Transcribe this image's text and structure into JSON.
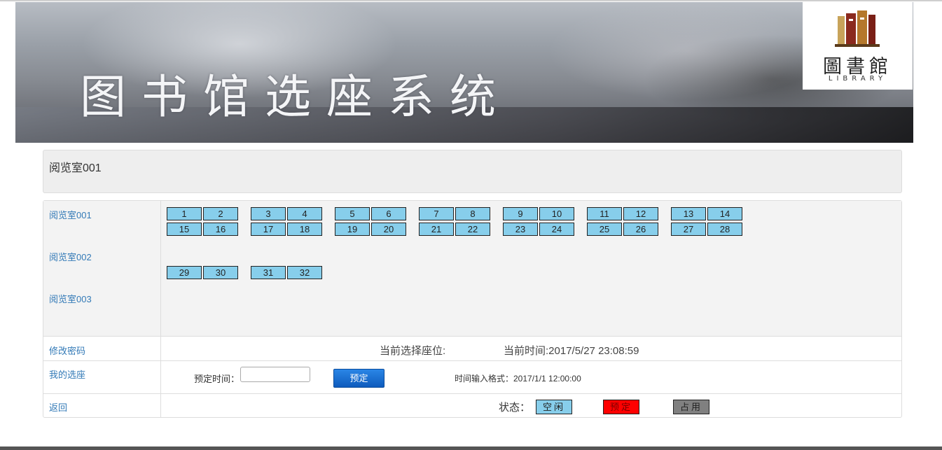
{
  "banner": {
    "title": "图书馆选座系统",
    "logo_cn": "圖書館",
    "logo_en": "LIBRARY"
  },
  "header": {
    "room_title": "阅览室001"
  },
  "sidebar": {
    "rooms": [
      "阅览室001",
      "阅览室002",
      "阅览室003"
    ],
    "actions": [
      "修改密码",
      "我的选座",
      "返回"
    ]
  },
  "seats": {
    "row1": [
      "1",
      "2",
      "3",
      "4",
      "5",
      "6",
      "7",
      "8",
      "9",
      "10",
      "11",
      "12",
      "13",
      "14"
    ],
    "row2": [
      "15",
      "16",
      "17",
      "18",
      "19",
      "20",
      "21",
      "22",
      "23",
      "24",
      "25",
      "26",
      "27",
      "28"
    ],
    "row3": [
      "29",
      "30",
      "31",
      "32"
    ],
    "colors": {
      "free": "#87ceeb",
      "booked": "#ff0000",
      "occupied": "#808080"
    }
  },
  "info": {
    "current_seat_label": "当前选择座位:",
    "current_time_label": "当前时间:2017/5/27 23:08:59"
  },
  "booking": {
    "time_label": "预定时间：",
    "time_value": "",
    "button_label": "预定",
    "format_hint": "时间输入格式：2017/1/1 12:00:00"
  },
  "status": {
    "label": "状态：",
    "legend": [
      {
        "name": "空闲",
        "color": "#87ceeb"
      },
      {
        "name": "预定",
        "color": "#ff0000"
      },
      {
        "name": "占用",
        "color": "#808080"
      }
    ]
  }
}
